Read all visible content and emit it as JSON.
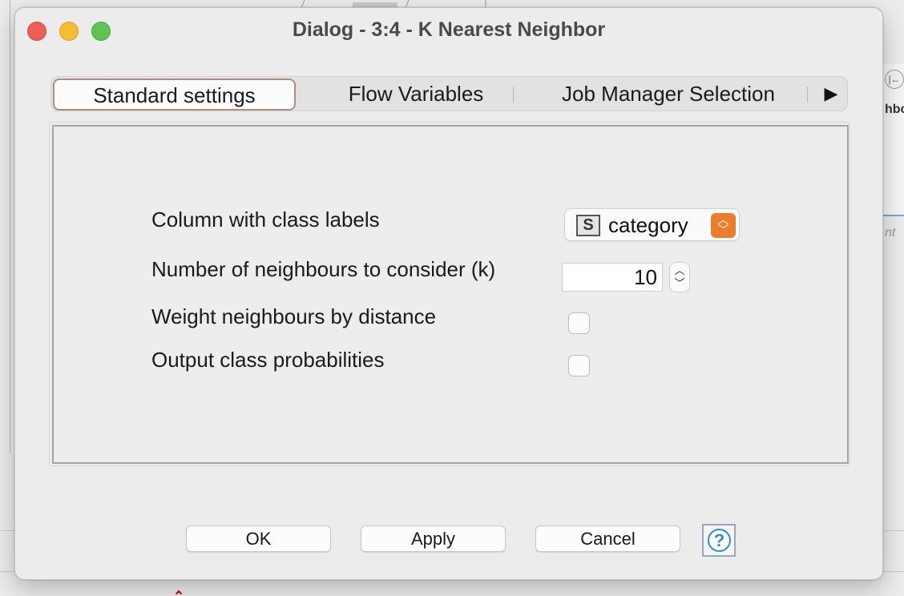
{
  "window": {
    "title": "Dialog - 3:4 - K Nearest Neighbor"
  },
  "tabs": [
    {
      "label": "Standard settings",
      "active": true
    },
    {
      "label": "Flow Variables",
      "active": false
    },
    {
      "label": "Job Manager Selection",
      "active": false
    }
  ],
  "tabs_more_icon": "play-triangle",
  "form": {
    "class_column_label": "Column with class labels",
    "class_column_type_badge": "S",
    "class_column_value": "category",
    "k_label": "Number of neighbours to consider (k)",
    "k_value": "10",
    "weight_label": "Weight neighbours by distance",
    "weight_checked": false,
    "output_prob_label": "Output class probabilities",
    "output_prob_checked": false
  },
  "buttons": {
    "ok": "OK",
    "apply": "Apply",
    "cancel": "Cancel",
    "help_glyph": "?"
  },
  "background": {
    "right_panel_text": "hbc",
    "right_panel_italic": "nt",
    "right_panel_icon": "|←"
  },
  "colors": {
    "accent_orange": "#ee7d2b",
    "help_blue": "#2f8fd6",
    "traffic_close": "#ec5f57",
    "traffic_minimize": "#f4bd34",
    "traffic_maximize": "#5fc454"
  }
}
